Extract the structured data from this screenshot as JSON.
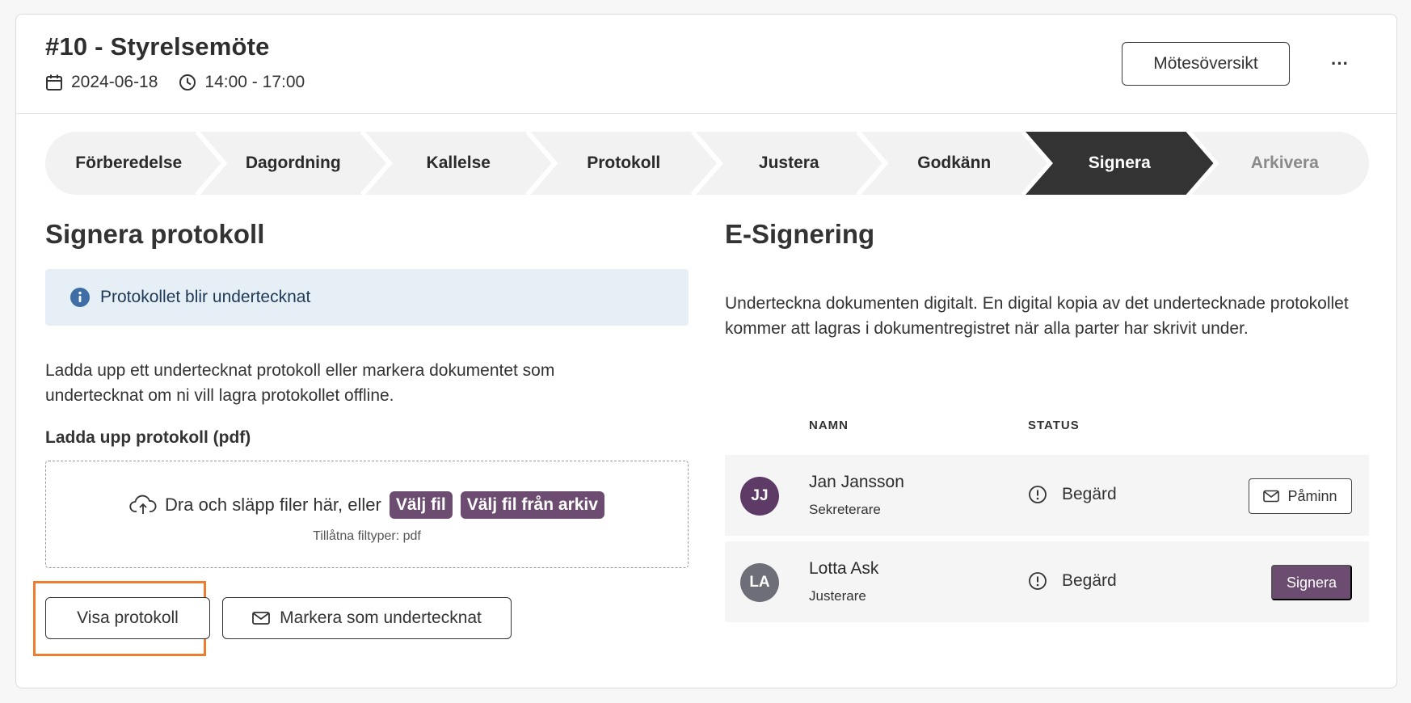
{
  "meeting": {
    "title": "#10 - Styrelsemöte",
    "date": "2024-06-18",
    "time": "14:00 - 17:00",
    "overview_label": "Mötesöversikt",
    "more_label": "···",
    "date_icon": "calendar-icon",
    "time_icon": "clock-icon"
  },
  "steps": [
    {
      "label": "Förberedelse",
      "state": "done"
    },
    {
      "label": "Dagordning",
      "state": "done"
    },
    {
      "label": "Kallelse",
      "state": "done"
    },
    {
      "label": "Protokoll",
      "state": "done"
    },
    {
      "label": "Justera",
      "state": "done"
    },
    {
      "label": "Godkänn",
      "state": "done"
    },
    {
      "label": "Signera",
      "state": "active"
    },
    {
      "label": "Arkivera",
      "state": "upcoming"
    }
  ],
  "sign": {
    "title": "Signera protokoll",
    "info_text": "Protokollet blir undertecknat",
    "description": "Ladda upp ett undertecknat protokoll eller markera dokumentet som undertecknat om ni vill lagra protokollet offline.",
    "upload_label": "Ladda upp protokoll (pdf)",
    "dropzone_text": "Dra och släpp filer här, eller",
    "choose_file": "Välj fil",
    "choose_archive": "Välj fil från arkiv",
    "allowed_types": "Tillåtna filtyper: pdf",
    "view_button": "Visa protokoll",
    "mark_signed_button": "Markera som undertecknat"
  },
  "esign": {
    "title": "E-Signering",
    "description": "Underteckna dokumenten digitalt. En digital kopia av det undertecknade protokollet kommer att lagras i dokumentregistret när alla parter har skrivit under.",
    "col_name": "NAMN",
    "col_status": "STATUS",
    "signers": [
      {
        "initials": "JJ",
        "name": "Jan Jansson",
        "role": "Sekreterare",
        "status": "Begärd",
        "action": "Påminn",
        "avatar_color": "#5e3a66"
      },
      {
        "initials": "LA",
        "name": "Lotta Ask",
        "role": "Justerare",
        "status": "Begärd",
        "action": "Signera",
        "avatar_color": "#6e6e78"
      }
    ]
  },
  "colors": {
    "accent": "#6c4c70",
    "active_step": "#333333",
    "step_bg": "#f2f2f2",
    "info_bg": "#e6eef6",
    "highlight": "#ef7d2f"
  }
}
